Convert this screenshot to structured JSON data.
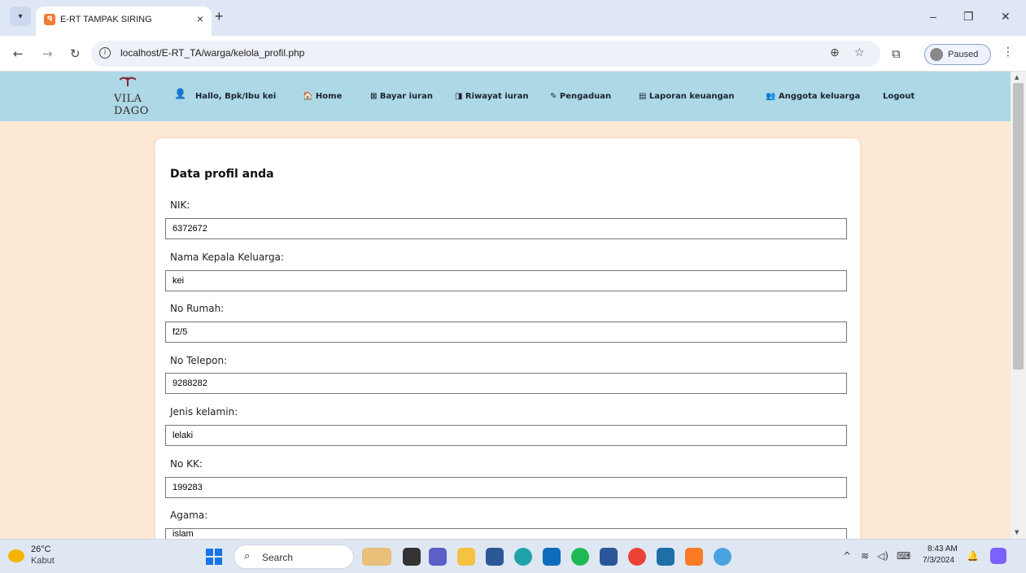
{
  "browser": {
    "tab_title": "E-RT TAMPAK SIRING",
    "tab_close": "×",
    "new_tab": "+",
    "url": "localhost/E-RT_TA/warga/kelola_profil.php",
    "profile_status": "Paused",
    "window_minimize": "–",
    "window_restore": "❐",
    "window_close": "✕"
  },
  "site": {
    "logo_text": "VILA DAGO",
    "nav": {
      "greeting": "Hallo, Bpk/Ibu kei",
      "home": "🏠 Home",
      "bayar_iuran": "⊠ Bayar iuran",
      "riwayat_iuran": "◨ Riwayat iuran",
      "pengaduan": "✎ Pengaduan",
      "laporan_keuangan": "▤ Laporan keuangan",
      "anggota_keluarga": "👥 Anggota keluarga",
      "logout": "Logout"
    }
  },
  "profile": {
    "title": "Data profil anda",
    "fields": [
      {
        "label": "NIK:",
        "value": "6372672"
      },
      {
        "label": "Nama Kepala Keluarga:",
        "value": "kei"
      },
      {
        "label": "No Rumah:",
        "value": "f2/5"
      },
      {
        "label": "No Telepon:",
        "value": "9288282"
      },
      {
        "label": "Jenis kelamin:",
        "value": "lelaki"
      },
      {
        "label": "No KK:",
        "value": "199283"
      },
      {
        "label": "Agama:",
        "value": "islam"
      }
    ]
  },
  "taskbar": {
    "temperature": "26°C",
    "weather": "Kabut",
    "search_placeholder": "Search",
    "time": "8:43 AM",
    "date": "7/3/2024"
  },
  "colors": {
    "navbar": "#add8e6",
    "page_bg": "#fde8d4",
    "card_bg": "#ffffff"
  }
}
